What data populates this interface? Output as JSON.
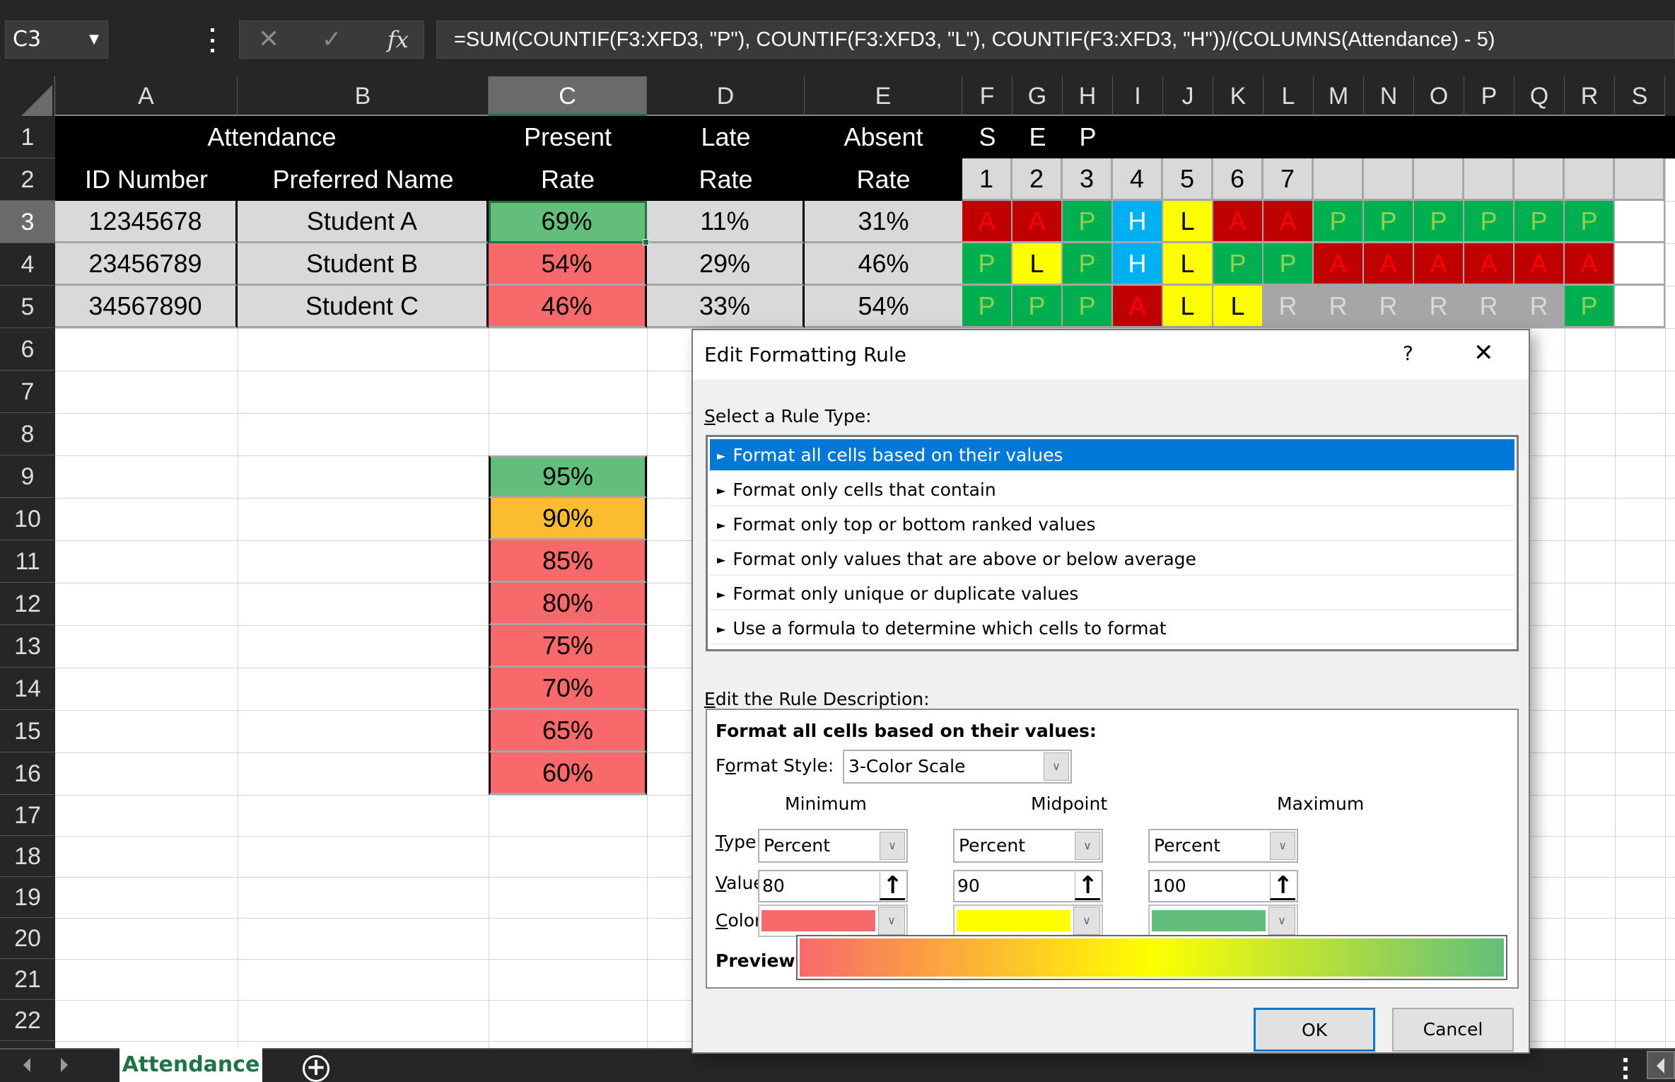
{
  "formula_bar": {
    "name_box": "C3",
    "formula": "=SUM(COUNTIF(F3:XFD3, \"P\"), COUNTIF(F3:XFD3, \"L\"), COUNTIF(F3:XFD3, \"H\"))/(COLUMNS(Attendance) - 5)",
    "cancel_icon": "✕",
    "enter_icon": "✓",
    "fx_icon": "fx",
    "name_box_caret": "▼"
  },
  "columns": [
    "A",
    "B",
    "C",
    "D",
    "E",
    "F",
    "G",
    "H",
    "I",
    "J",
    "K",
    "L",
    "M",
    "N",
    "O",
    "P",
    "Q",
    "R",
    "S"
  ],
  "selected_column": "C",
  "rows": [
    "1",
    "2",
    "3",
    "4",
    "5",
    "6",
    "7",
    "8",
    "9",
    "10",
    "11",
    "12",
    "13",
    "14",
    "15",
    "16",
    "17",
    "18",
    "19",
    "20",
    "21",
    "22"
  ],
  "selected_row": "3",
  "table": {
    "header_row1": {
      "attendance": "Attendance",
      "present": "Present",
      "late": "Late",
      "absent": "Absent"
    },
    "header_row2": {
      "id": "ID Number",
      "name": "Preferred Name",
      "present": "Rate",
      "late": "Rate",
      "absent": "Rate"
    },
    "students": [
      {
        "id": "12345678",
        "name": "Student A",
        "present": "69%",
        "late": "11%",
        "absent": "31%",
        "present_color": "#63be7b"
      },
      {
        "id": "23456789",
        "name": "Student B",
        "present": "54%",
        "late": "29%",
        "absent": "46%",
        "present_color": "#f8696b"
      },
      {
        "id": "34567890",
        "name": "Student C",
        "present": "46%",
        "late": "33%",
        "absent": "54%",
        "present_color": "#f8696b"
      }
    ]
  },
  "attendance_grid": {
    "month": [
      "S",
      "E",
      "P"
    ],
    "days": [
      "1",
      "2",
      "3",
      "4",
      "5",
      "6",
      "7",
      "",
      "",
      "",
      "",
      "",
      "",
      ""
    ],
    "marks": [
      [
        "A",
        "A",
        "P",
        "H",
        "L",
        "A",
        "A",
        "P",
        "P",
        "P",
        "P",
        "P",
        "P",
        ""
      ],
      [
        "P",
        "L",
        "P",
        "H",
        "L",
        "P",
        "P",
        "A",
        "A",
        "A",
        "A",
        "A",
        "A",
        ""
      ],
      [
        "P",
        "P",
        "P",
        "A",
        "L",
        "L",
        "R",
        "R",
        "R",
        "R",
        "R",
        "R",
        "P",
        ""
      ]
    ],
    "legend_colors": {
      "A": "#c00000",
      "P": "#00b050",
      "H": "#00b0f0",
      "L": "#ffff00",
      "R": "#a6a6a6"
    }
  },
  "scale_samples": [
    {
      "value": "95%",
      "color": "#63be7b"
    },
    {
      "value": "90%",
      "color": "#fbbd2f"
    },
    {
      "value": "85%",
      "color": "#f8696b"
    },
    {
      "value": "80%",
      "color": "#f8696b"
    },
    {
      "value": "75%",
      "color": "#f8696b"
    },
    {
      "value": "70%",
      "color": "#f8696b"
    },
    {
      "value": "65%",
      "color": "#f8696b"
    },
    {
      "value": "60%",
      "color": "#f8696b"
    }
  ],
  "sheet_tabs": {
    "active": "Attendance",
    "add_icon": "+"
  },
  "dialog": {
    "title": "Edit Formatting Rule",
    "help": "?",
    "close": "✕",
    "select_rule_label_u": "S",
    "select_rule_label_rest": "elect a Rule Type:",
    "rule_types": [
      "Format all cells based on their values",
      "Format only cells that contain",
      "Format only top or bottom ranked values",
      "Format only values that are above or below average",
      "Format only unique or duplicate values",
      "Use a formula to determine which cells to format"
    ],
    "selected_rule_index": 0,
    "edit_desc_label_u": "E",
    "edit_desc_label_rest": "dit the Rule Description:",
    "desc_title": "Format all cells based on their values:",
    "format_style_label_a": "F",
    "format_style_label_u": "o",
    "format_style_label_rest": "rmat Style:",
    "format_style_value": "3-Color Scale",
    "col_headers": [
      "Minimum",
      "Midpoint",
      "Maximum"
    ],
    "type_label_u": "T",
    "type_label_rest": "ype:",
    "value_label_u": "V",
    "value_label_rest": "alue:",
    "color_label_u": "C",
    "color_label_rest": "olor:",
    "types": [
      "Percent",
      "Percent",
      "Percent"
    ],
    "values": [
      "80",
      "90",
      "100"
    ],
    "colors": [
      "#f8696b",
      "#ffff00",
      "#63be7b"
    ],
    "preview_label": "Preview:",
    "ok": "OK",
    "cancel": "Cancel",
    "dropdown_icon": "∨",
    "ref_icon": "↑"
  }
}
